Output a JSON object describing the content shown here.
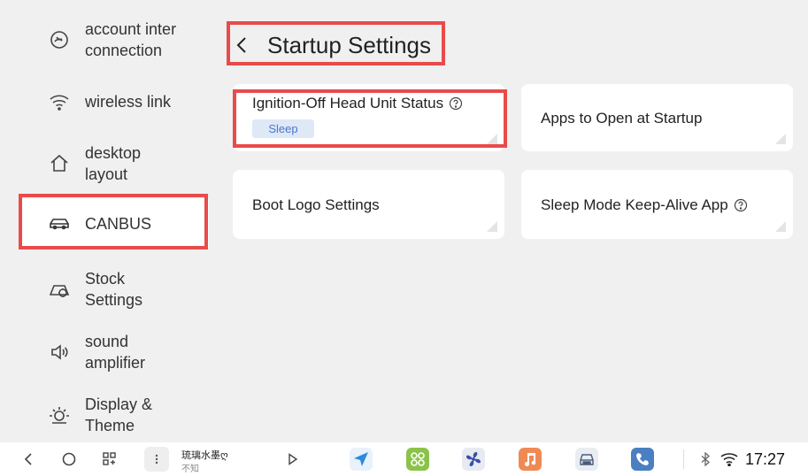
{
  "sidebar": {
    "items": [
      {
        "label_line1": "account inter",
        "label_line2": "connection",
        "icon": "cloud-link-icon"
      },
      {
        "label_line1": "wireless link",
        "label_line2": "",
        "icon": "wifi-icon"
      },
      {
        "label_line1": "desktop",
        "label_line2": "layout",
        "icon": "home-icon"
      },
      {
        "label_line1": "CANBUS",
        "label_line2": "",
        "icon": "car-icon",
        "active": true
      },
      {
        "label_line1": "Stock",
        "label_line2": "Settings",
        "icon": "gear-wrench-icon"
      },
      {
        "label_line1": "sound",
        "label_line2": "amplifier",
        "icon": "speaker-icon"
      },
      {
        "label_line1": "Display &",
        "label_line2": "Theme",
        "icon": "sun-icon"
      }
    ]
  },
  "header": {
    "title": "Startup Settings"
  },
  "cards": {
    "ignition": {
      "label": "Ignition-Off Head Unit Status",
      "value": "Sleep"
    },
    "apps_startup": {
      "label": "Apps to Open at Startup"
    },
    "boot_logo": {
      "label": "Boot Logo Settings"
    },
    "keep_alive": {
      "label": "Sleep Mode Keep-Alive App"
    }
  },
  "taskbar": {
    "media_title": "琉璃水墨ღ",
    "media_subtitle": "不知",
    "clock": "17:27"
  },
  "colors": {
    "highlight": "#e94b4b",
    "badge_bg": "#dfe8f7",
    "badge_text": "#4a78c8"
  }
}
